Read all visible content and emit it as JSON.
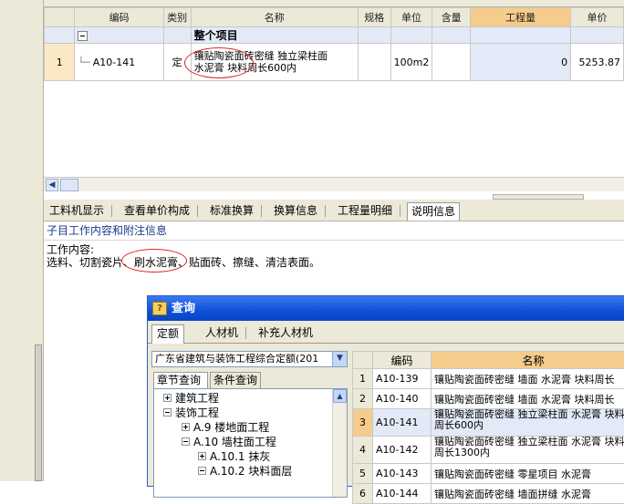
{
  "grid": {
    "headers": [
      "编码",
      "类别",
      "名称",
      "规格",
      "单位",
      "含量",
      "工程量",
      "单价"
    ],
    "group_row": {
      "label": "整个项目"
    },
    "row": {
      "num": "1",
      "code": "A10-141",
      "type": "定",
      "name_line1": "镶贴陶瓷面砖密缝 独立梁柱面",
      "name_line2": "水泥膏 块料周长600内",
      "unit": "100m2",
      "quantity": "0",
      "price": "5253.87"
    }
  },
  "lower_tabs": [
    "工料机显示",
    "查看单价构成",
    "标准换算",
    "换算信息",
    "工程量明细",
    "说明信息"
  ],
  "lower_active_tab": "说明信息",
  "section_title": "子目工作内容和附注信息",
  "work_content": {
    "label": "工作内容:",
    "text": "选料、切割瓷片、刷水泥膏、贴面砖、擦缝、清洁表面。"
  },
  "dialog": {
    "title": "查询",
    "tabs": [
      "定额",
      "人材机",
      "补充人材机"
    ],
    "active_tab": "定额",
    "select_value": "广东省建筑与装饰工程综合定额(201",
    "left_tabs": [
      "章节查询",
      "条件查询"
    ],
    "tree": [
      {
        "label": "建筑工程",
        "level": 0,
        "expanded": false
      },
      {
        "label": "装饰工程",
        "level": 0,
        "expanded": true
      },
      {
        "label": "A.9 楼地面工程",
        "level": 1,
        "expanded": false
      },
      {
        "label": "A.10 墙柱面工程",
        "level": 1,
        "expanded": true
      },
      {
        "label": "A.10.1 抹灰",
        "level": 2,
        "expanded": false
      },
      {
        "label": "A.10.2 块料面层",
        "level": 2,
        "expanded": true
      }
    ],
    "result_headers": [
      "编码",
      "名称"
    ],
    "results": [
      {
        "num": "1",
        "code": "A10-139",
        "name": "镶贴陶瓷面砖密缝 墙面 水泥膏 块料周长"
      },
      {
        "num": "2",
        "code": "A10-140",
        "name": "镶贴陶瓷面砖密缝 墙面 水泥膏 块料周长"
      },
      {
        "num": "3",
        "code": "A10-141",
        "name": "镶贴陶瓷面砖密缝 独立梁柱面 水泥膏 块料周长600内"
      },
      {
        "num": "4",
        "code": "A10-142",
        "name": "镶贴陶瓷面砖密缝 独立梁柱面 水泥膏 块料周长1300内"
      },
      {
        "num": "5",
        "code": "A10-143",
        "name": "镶贴陶瓷面砖密缝 零星项目 水泥膏"
      },
      {
        "num": "6",
        "code": "A10-144",
        "name": "镶贴陶瓷面砖密缝 墙面拼缝 水泥膏"
      }
    ]
  },
  "colors": {
    "header_highlight": "#f5cc8c",
    "selection_blue": "#e3e9f6",
    "annotation_red": "#e02020",
    "titlebar_blue": "#0d4fd8"
  }
}
